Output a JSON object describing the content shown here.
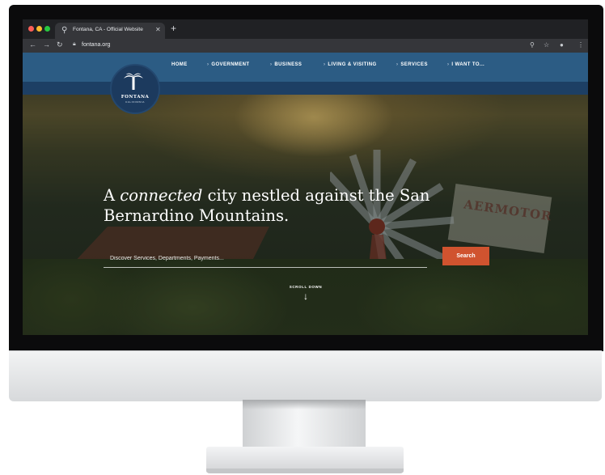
{
  "browser": {
    "tab_title": "Fontana, CA - Official Website",
    "tab_favicon": "city-logo-icon",
    "close_icon": "close-icon",
    "new_tab_icon": "plus-icon",
    "url": "fontana.org",
    "window_controls": [
      "#ff5f57",
      "#febc2e",
      "#28c840"
    ]
  },
  "site": {
    "logo_name": "FONTANA",
    "logo_subtitle": "CALIFORNIA",
    "nav": [
      {
        "label": "HOME"
      },
      {
        "label": "GOVERNMENT"
      },
      {
        "label": "BUSINESS"
      },
      {
        "label": "LIVING & VISITING"
      },
      {
        "label": "SERVICES"
      },
      {
        "label": "I WANT TO..."
      }
    ],
    "headline_prefix": "A ",
    "headline_emphasis": "connected",
    "headline_rest": " city nestled against the San Bernardino Mountains.",
    "search_placeholder": "Discover Services, Departments, Payments...",
    "search_button": "Search",
    "scroll_label": "SCROLL DOWN",
    "scroll_arrow": "↓",
    "sign_text": "AERMOTOR",
    "colors": {
      "nav_blue": "#2c5c84",
      "nav_dark": "#1d3f64",
      "accent": "#d0532f"
    }
  }
}
